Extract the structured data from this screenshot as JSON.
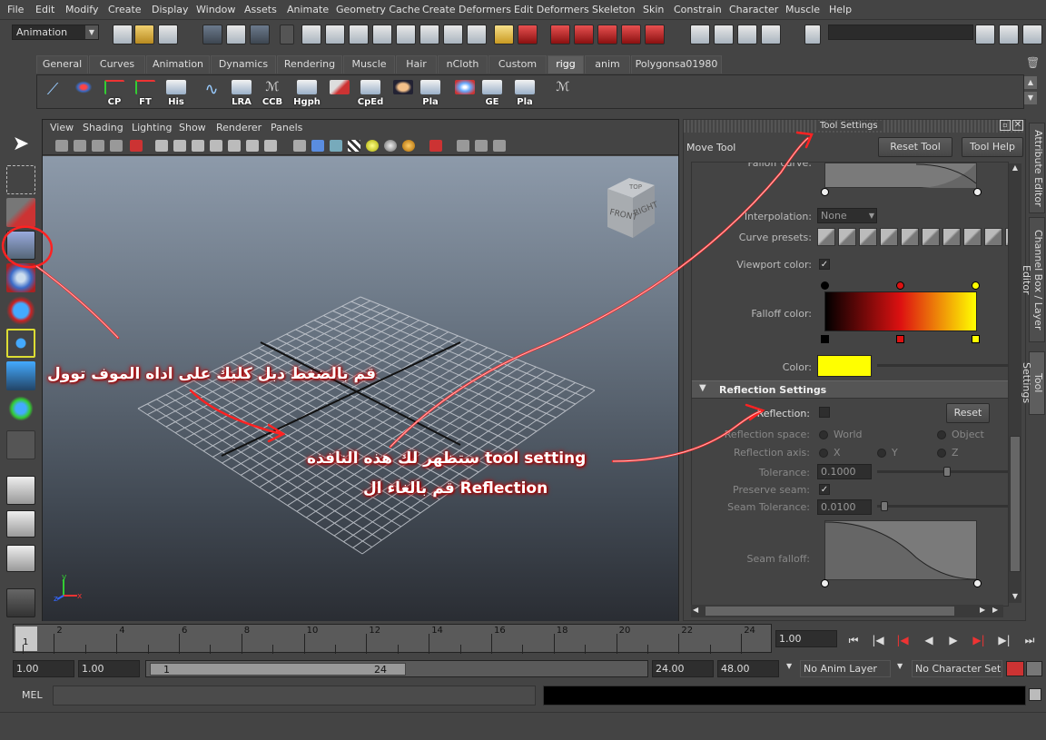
{
  "menu": [
    "File",
    "Edit",
    "Modify",
    "Create",
    "Display",
    "Window",
    "Assets",
    "Animate",
    "Geometry Cache",
    "Create Deformers",
    "Edit Deformers",
    "Skeleton",
    "Skin",
    "Constrain",
    "Character",
    "Muscle",
    "Help"
  ],
  "mode_select": "Animation",
  "shelf_tabs": [
    "General",
    "Curves",
    "Animation",
    "Dynamics",
    "Rendering",
    "Muscle",
    "Hair",
    "nCloth",
    "Custom",
    "rigg",
    "anim",
    "Polygonsa01980"
  ],
  "active_shelf_tab": "rigg",
  "shelf_buttons": [
    "",
    "",
    "CP",
    "FT",
    "His",
    "",
    "LRA",
    "CCB",
    "Hgph",
    "",
    "CpEd",
    "",
    "Pla",
    "",
    "GE",
    "Pla",
    ""
  ],
  "viewport": {
    "menu": [
      "View",
      "Shading",
      "Lighting",
      "Show",
      "Renderer",
      "Panels"
    ],
    "cube_labels": {
      "top": "TOP",
      "front": "FRONT",
      "right": "RIGHT"
    },
    "axis": {
      "x": "x",
      "y": "y",
      "z": "z"
    }
  },
  "tool_settings": {
    "title": "Tool Settings",
    "tool_name": "Move Tool",
    "reset_tool": "Reset Tool",
    "tool_help": "Tool Help",
    "falloff_curve_label": "Falloff curve:",
    "interpolation_label": "Interpolation:",
    "interpolation_value": "None",
    "curve_presets_label": "Curve presets:",
    "viewport_color_label": "Viewport color:",
    "viewport_color_checked": true,
    "falloff_color_label": "Falloff color:",
    "color_label": "Color:",
    "color_value": "#ffff00",
    "reflection_section": "Reflection Settings",
    "reflection_label": "Reflection:",
    "reset_label": "Reset",
    "reflection_space_label": "Reflection space:",
    "reflection_space_options": [
      "World",
      "Object"
    ],
    "reflection_axis_label": "Reflection axis:",
    "reflection_axis_options": [
      "X",
      "Y",
      "Z"
    ],
    "tolerance_label": "Tolerance:",
    "tolerance_value": "0.1000",
    "preserve_seam_label": "Preserve seam:",
    "seam_tolerance_label": "Seam Tolerance:",
    "seam_tolerance_value": "0.0100",
    "seam_falloff_label": "Seam falloff:"
  },
  "side_tabs": [
    "Attribute Editor",
    "Channel Box / Layer Editor",
    "Tool Settings"
  ],
  "timeline": {
    "ticks": [
      "2",
      "4",
      "6",
      "8",
      "10",
      "12",
      "14",
      "16",
      "18",
      "20",
      "22",
      "24"
    ],
    "start_marker": "1",
    "current_frame": "1.00"
  },
  "range": {
    "start_time": "1.00",
    "playback_start": "1.00",
    "range_start": "1",
    "range_end": "24",
    "playback_end": "24.00",
    "end_time": "48.00",
    "anim_layer": "No Anim Layer",
    "character_set": "No Character Set"
  },
  "command_line": {
    "label": "MEL"
  },
  "annotations": {
    "line1": "قم بالضغط دبل كليك على اداه الموف توول",
    "line2": "ستظهر لك هذه النافذه tool setting",
    "line3": "قم بالغاء ال Reflection"
  },
  "colors": {
    "annotation": "#ff3333",
    "falloff_start": "#000000",
    "falloff_mid": "#dd1111",
    "falloff_end": "#ffff00"
  }
}
